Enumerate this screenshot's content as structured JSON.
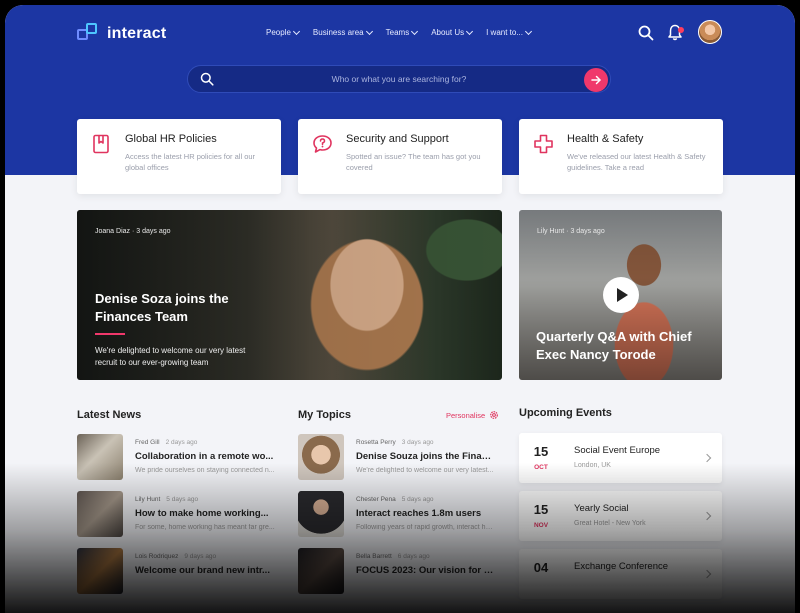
{
  "header": {
    "logo_text": "interact",
    "nav": [
      "People",
      "Business area",
      "Teams",
      "About Us",
      "I want to..."
    ]
  },
  "search": {
    "placeholder": "Who or what you are searching for?"
  },
  "quick_links": [
    {
      "title": "Global HR Policies",
      "desc": "Access the latest HR policies for all our global offices",
      "icon": "bookmark-document-icon"
    },
    {
      "title": "Security and Support",
      "desc": "Spotted an issue? The team has got you covered",
      "icon": "help-chat-icon"
    },
    {
      "title": "Health & Safety",
      "desc": "We've released our latest Health & Safety guidelines. Take a read",
      "icon": "medical-cross-icon"
    }
  ],
  "feature": {
    "author": "Joana Diaz",
    "time": "3 days ago",
    "title": "Denise Soza joins the Finances Team",
    "desc": "We're delighted to welcome our very latest recruit to our ever-growing team"
  },
  "video": {
    "author": "Lily Hunt",
    "time": "3 days ago",
    "title": "Quarterly Q&A with Chief Exec Nancy Torode"
  },
  "latest_news": {
    "heading": "Latest News",
    "items": [
      {
        "author": "Fred Gill",
        "time": "2 days ago",
        "title": "Collaboration in a remote wo...",
        "snippet": "We pride ourselves on staying connected n..."
      },
      {
        "author": "Lily Hunt",
        "time": "5 days ago",
        "title": "How to make home working...",
        "snippet": "For some, home working has meant far gre..."
      },
      {
        "author": "Lois Rodriquez",
        "time": "9 days ago",
        "title": "Welcome our brand new intr...",
        "snippet": ""
      }
    ]
  },
  "my_topics": {
    "heading": "My Topics",
    "personalise": "Personalise",
    "items": [
      {
        "author": "Rosetta Perry",
        "time": "3 days ago",
        "title": "Denise Souza joins the Financ...",
        "snippet": "We're delighted to welcome our very latest..."
      },
      {
        "author": "Chester Pena",
        "time": "5 days ago",
        "title": "Interact reaches 1.8m users",
        "snippet": "Following years of rapid growth, interact has..."
      },
      {
        "author": "Bella Barrett",
        "time": "6 days ago",
        "title": "FOCUS 2023: Our vision for th...",
        "snippet": ""
      }
    ]
  },
  "events": {
    "heading": "Upcoming Events",
    "items": [
      {
        "day": "15",
        "month": "OCT",
        "title": "Social Event Europe",
        "location": "London, UK"
      },
      {
        "day": "15",
        "month": "NOV",
        "title": "Yearly Social",
        "location": "Great Hotel - New York"
      },
      {
        "day": "04",
        "month": "",
        "title": "Exchange Conference",
        "location": ""
      }
    ]
  },
  "colors": {
    "brand": "#1c36a3",
    "accent": "#f0386b"
  }
}
